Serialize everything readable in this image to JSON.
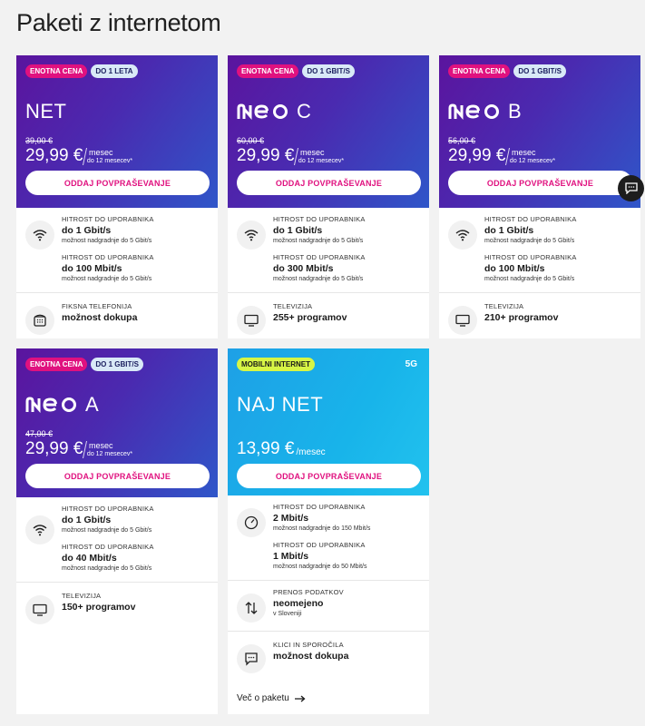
{
  "page": {
    "title": "Paketi z internetom"
  },
  "colors": {
    "brand_pink": "#e0117f",
    "purple_start": "#5b149e",
    "purple_end": "#2f56c9",
    "cyan": "#1ea0e6",
    "lime": "#d7f545"
  },
  "cta_label": "ODDAJ POVPRAŠEVANJE",
  "cards": [
    {
      "badges": [
        "ENOTNA CENA",
        "DO 1 LETA"
      ],
      "name": "NET",
      "old_price": "39,00 €",
      "price": "29,99 €",
      "per": "mesec",
      "term": "do 12 mesecev*",
      "features": [
        {
          "icon": "wifi-icon",
          "groups": [
            {
              "label": "HITROST DO UPORABNIKA",
              "value": "do 1 Gbit/s",
              "sub": "možnost nadgradnje do 5 Gbit/s"
            },
            {
              "label": "HITROST OD UPORABNIKA",
              "value": "do 100 Mbit/s",
              "sub": "možnost nadgradnje do 5 Gbit/s"
            }
          ]
        },
        {
          "icon": "phone-icon",
          "groups": [
            {
              "label": "FIKSNA TELEFONIJA",
              "value": "možnost dokupa"
            }
          ]
        }
      ]
    },
    {
      "badges": [
        "ENOTNA CENA",
        "DO 1 GBIT/S"
      ],
      "logo": "neo",
      "name": "C",
      "old_price": "60,00 €",
      "price": "29,99 €",
      "per": "mesec",
      "term": "do 12 mesecev*",
      "features": [
        {
          "icon": "wifi-icon",
          "groups": [
            {
              "label": "HITROST DO UPORABNIKA",
              "value": "do 1 Gbit/s",
              "sub": "možnost nadgradnje do 5 Gbit/s"
            },
            {
              "label": "HITROST OD UPORABNIKA",
              "value": "do 300 Mbit/s",
              "sub": "možnost nadgradnje do 5 Gbit/s"
            }
          ]
        },
        {
          "icon": "tv-icon",
          "groups": [
            {
              "label": "TELEVIZIJA",
              "value": "255+ programov"
            }
          ]
        }
      ]
    },
    {
      "badges": [
        "ENOTNA CENA",
        "DO 1 GBIT/S"
      ],
      "logo": "neo",
      "name": "B",
      "old_price": "56,00 €",
      "price": "29,99 €",
      "per": "mesec",
      "term": "do 12 mesecev*",
      "features": [
        {
          "icon": "wifi-icon",
          "groups": [
            {
              "label": "HITROST DO UPORABNIKA",
              "value": "do 1 Gbit/s",
              "sub": "možnost nadgradnje do 5 Gbit/s"
            },
            {
              "label": "HITROST OD UPORABNIKA",
              "value": "do 100 Mbit/s",
              "sub": "možnost nadgradnje do 5 Gbit/s"
            }
          ]
        },
        {
          "icon": "tv-icon",
          "groups": [
            {
              "label": "TELEVIZIJA",
              "value": "210+ programov"
            }
          ]
        }
      ]
    },
    {
      "badges": [
        "ENOTNA CENA",
        "DO 1 GBIT/S"
      ],
      "logo": "neo",
      "name": "A",
      "old_price": "47,00 €",
      "price": "29,99 €",
      "per": "mesec",
      "term": "do 12 mesecev*",
      "features": [
        {
          "icon": "wifi-icon",
          "groups": [
            {
              "label": "HITROST DO UPORABNIKA",
              "value": "do 1 Gbit/s",
              "sub": "možnost nadgradnje do 5 Gbit/s"
            },
            {
              "label": "HITROST OD UPORABNIKA",
              "value": "do 40 Mbit/s",
              "sub": "možnost nadgradnje do 5 Gbit/s"
            }
          ]
        },
        {
          "icon": "tv-icon",
          "groups": [
            {
              "label": "TELEVIZIJA",
              "value": "150+ programov"
            }
          ]
        }
      ]
    },
    {
      "badges": [
        "MOBILNI INTERNET"
      ],
      "network": "5G",
      "name": "NAJ NET",
      "price": "13,99 €",
      "per": "/mesec",
      "features": [
        {
          "icon": "speedometer-icon",
          "groups": [
            {
              "label": "HITROST DO UPORABNIKA",
              "value": "2 Mbit/s",
              "sub": "možnost nadgradnje do 150 Mbit/s"
            },
            {
              "label": "HITROST OD UPORABNIKA",
              "value": "1 Mbit/s",
              "sub": "možnost nadgradnje do 50 Mbit/s"
            }
          ]
        },
        {
          "icon": "transfer-arrows-icon",
          "groups": [
            {
              "label": "PRENOS PODATKOV",
              "value": "neomejeno",
              "sub": "v Sloveniji"
            }
          ]
        },
        {
          "icon": "message-icon",
          "groups": [
            {
              "label": "KLICI IN SPOROČILA",
              "value": "možnost dokupa"
            }
          ]
        }
      ],
      "more_link": "Več o paketu"
    }
  ],
  "chat": {
    "icon": "chat-icon"
  }
}
